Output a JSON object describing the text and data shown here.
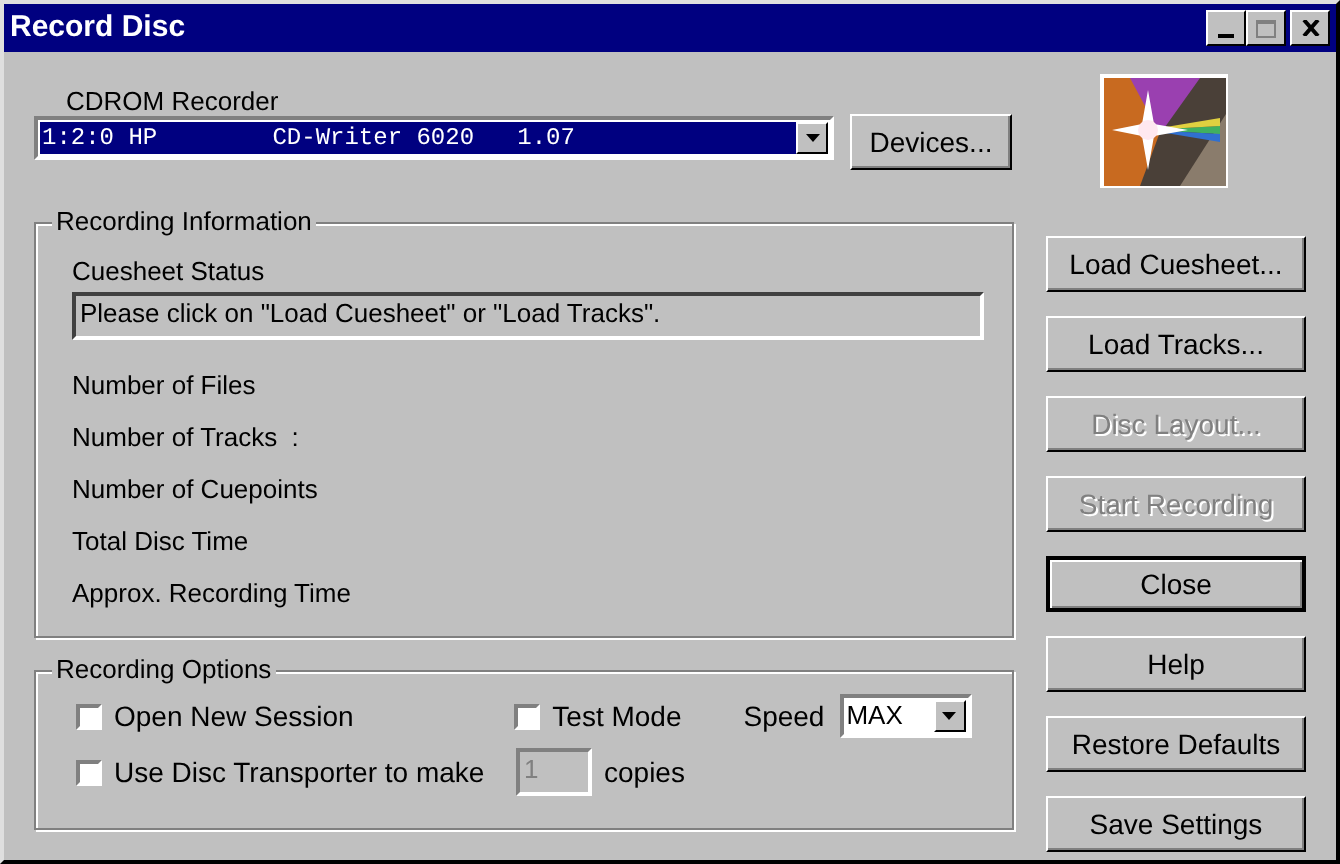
{
  "window": {
    "title": "Record Disc"
  },
  "recorder": {
    "label": "CDROM Recorder",
    "value": "1:2:0 HP        CD-Writer 6020   1.07"
  },
  "devices_button": {
    "label": "Devices..."
  },
  "recording_information": {
    "title": "Recording Information",
    "status_label": "Cuesheet Status",
    "status": "Please click on \"Load Cuesheet\" or \"Load Tracks\".",
    "fields": [
      "Number of Files",
      "Number of Tracks  :",
      "Number of Cuepoints",
      "Total Disc Time",
      "Approx. Recording Time"
    ]
  },
  "recording_options": {
    "title": "Recording Options",
    "open_new_session": {
      "label": "Open New Session",
      "checked": false
    },
    "test_mode": {
      "label": "Test Mode",
      "checked": false
    },
    "speed": {
      "label": "Speed",
      "value": "MAX"
    },
    "disc_transporter": {
      "label": "Use Disc Transporter to make",
      "checked": false
    },
    "copies": {
      "value": "1",
      "disabled": true,
      "suffix": "copies"
    }
  },
  "buttons": [
    {
      "label": "Load Cuesheet...",
      "disabled": false,
      "default": false
    },
    {
      "label": "Load Tracks...",
      "disabled": false,
      "default": false
    },
    {
      "label": "Disc Layout...",
      "disabled": true,
      "default": false
    },
    {
      "label": "Start Recording",
      "disabled": true,
      "default": false
    },
    {
      "label": "Close",
      "disabled": false,
      "default": true
    },
    {
      "label": "Help",
      "disabled": false,
      "default": false
    },
    {
      "label": "Restore Defaults",
      "disabled": false,
      "default": false
    },
    {
      "label": "Save Settings",
      "disabled": false,
      "default": false
    }
  ]
}
